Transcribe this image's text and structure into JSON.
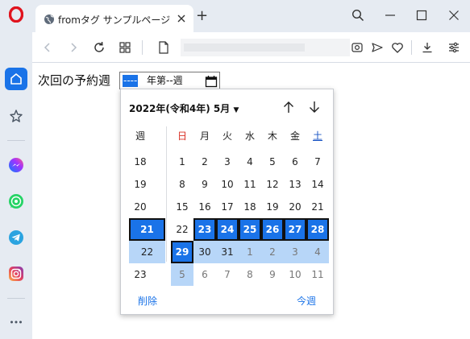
{
  "colors": {
    "accent": "#1a73e8",
    "highlight_week": "#b7d6f8",
    "sunday": "#d93025",
    "saturday": "#1a55c4",
    "opera_red": "#e0141e"
  },
  "browser": {
    "tab_title": "fromタグ サンプルページ",
    "new_tab_label": "+"
  },
  "sidebar": {
    "items": [
      {
        "name": "home-icon"
      },
      {
        "name": "pinboards-icon"
      },
      {
        "name": "messenger-icon"
      },
      {
        "name": "whatsapp-icon"
      },
      {
        "name": "telegram-icon"
      },
      {
        "name": "instagram-icon"
      },
      {
        "name": "more-icon"
      }
    ]
  },
  "form": {
    "label": "次回の予約週",
    "input_year": "----",
    "input_rest": "年第--週"
  },
  "picker": {
    "month_label": "2022年(令和4年) 5月",
    "headers": [
      "週",
      "日",
      "月",
      "火",
      "水",
      "木",
      "金",
      "土"
    ],
    "rows": [
      {
        "week": "18",
        "days": [
          "1",
          "2",
          "3",
          "4",
          "5",
          "6",
          "7"
        ]
      },
      {
        "week": "19",
        "days": [
          "8",
          "9",
          "10",
          "11",
          "12",
          "13",
          "14"
        ]
      },
      {
        "week": "20",
        "days": [
          "15",
          "16",
          "17",
          "18",
          "19",
          "20",
          "21"
        ]
      },
      {
        "week": "21",
        "days": [
          "22",
          "23",
          "24",
          "25",
          "26",
          "27",
          "28"
        ]
      },
      {
        "week": "22",
        "days": [
          "29",
          "30",
          "31",
          "1",
          "2",
          "3",
          "4"
        ]
      },
      {
        "week": "23",
        "days": [
          "5",
          "6",
          "7",
          "8",
          "9",
          "10",
          "11"
        ]
      }
    ],
    "clear_label": "削除",
    "this_week_label": "今週"
  }
}
